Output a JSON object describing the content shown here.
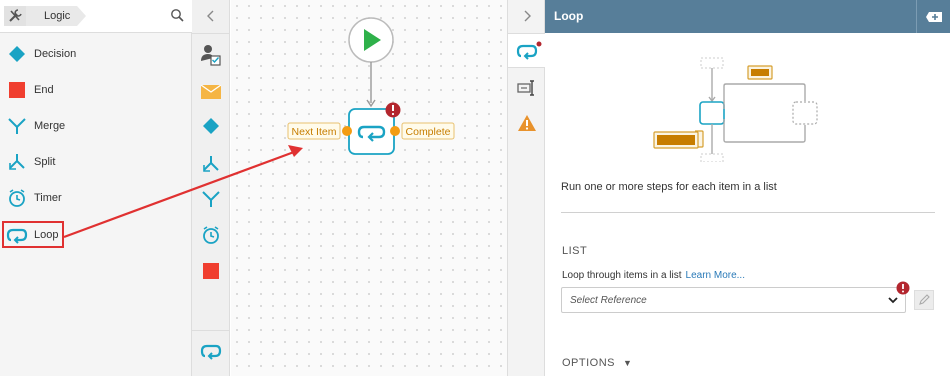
{
  "palette": {
    "category": "Logic",
    "items": [
      {
        "label": "Decision",
        "icon": "diamond-icon"
      },
      {
        "label": "End",
        "icon": "stop-square-icon"
      },
      {
        "label": "Merge",
        "icon": "merge-icon"
      },
      {
        "label": "Split",
        "icon": "split-icon"
      },
      {
        "label": "Timer",
        "icon": "timer-icon"
      },
      {
        "label": "Loop",
        "icon": "loop-icon"
      }
    ]
  },
  "canvas": {
    "next_item_label": "Next Item",
    "complete_label": "Complete"
  },
  "properties": {
    "title": "Loop",
    "description": "Run one or more steps for each item in a list",
    "list_heading": "LIST",
    "list_help": "Loop through items in a list",
    "learn_more": "Learn More...",
    "select_placeholder": "Select Reference",
    "options_heading": "OPTIONS"
  },
  "colors": {
    "accent": "#1aa3c4",
    "header": "#577e99",
    "error": "#b3262e",
    "annotation": "#e03131",
    "port": "#f39c12",
    "branch_label": "#c77d00"
  }
}
